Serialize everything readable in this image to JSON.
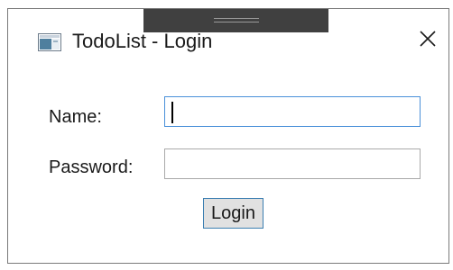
{
  "window": {
    "title": "TodoList - Login",
    "icon": "app-window-icon",
    "close_icon": "close-icon"
  },
  "form": {
    "name_label": "Name:",
    "name_value": "",
    "password_label": "Password:",
    "password_value": "",
    "login_label": "Login"
  },
  "colors": {
    "focus_border": "#4a90d9",
    "button_face": "#e1e1e1",
    "button_border": "#3c7fb1",
    "drag_bar": "#404040"
  }
}
